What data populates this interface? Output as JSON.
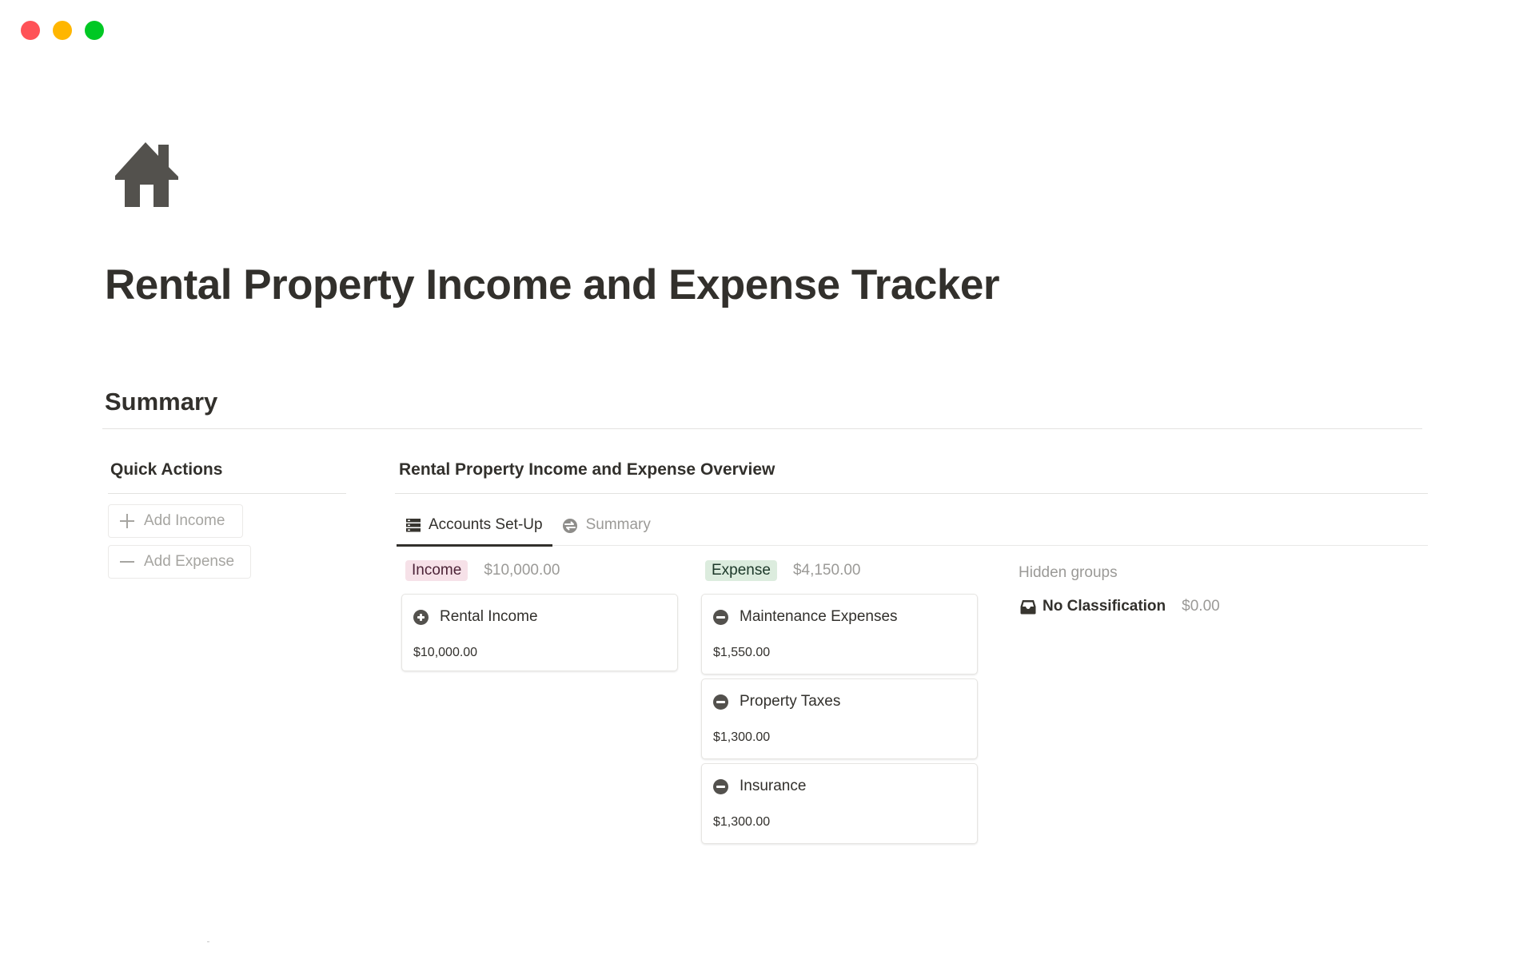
{
  "window": {
    "controls": [
      "close",
      "minimize",
      "maximize"
    ]
  },
  "page": {
    "icon": "house-icon",
    "title": "Rental Property Income and Expense Tracker"
  },
  "summary_section": {
    "heading": "Summary"
  },
  "quick_actions": {
    "heading": "Quick Actions",
    "buttons": [
      {
        "icon": "plus-icon",
        "label": "Add Income"
      },
      {
        "icon": "minus-icon",
        "label": "Add Expense"
      }
    ]
  },
  "overview": {
    "heading": "Rental Property Income and Expense Overview",
    "tabs": [
      {
        "icon": "table-icon",
        "label": "Accounts Set-Up",
        "active": true
      },
      {
        "icon": "sync-icon",
        "label": "Summary",
        "active": false
      }
    ],
    "groups": [
      {
        "tag": "Income",
        "tag_color": "#f6e1e8",
        "total": "$10,000.00",
        "cards": [
          {
            "icon": "plus-circle-icon",
            "title": "Rental Income",
            "amount": "$10,000.00"
          }
        ]
      },
      {
        "tag": "Expense",
        "tag_color": "#dcecde",
        "total": "$4,150.00",
        "cards": [
          {
            "icon": "minus-circle-icon",
            "title": "Maintenance Expenses",
            "amount": "$1,550.00"
          },
          {
            "icon": "minus-circle-icon",
            "title": "Property Taxes",
            "amount": "$1,300.00"
          },
          {
            "icon": "minus-circle-icon",
            "title": "Insurance",
            "amount": "$1,300.00"
          }
        ]
      }
    ],
    "hidden_groups": {
      "label": "Hidden groups",
      "items": [
        {
          "icon": "inbox-icon",
          "name": "No Classification",
          "total": "$0.00"
        }
      ]
    }
  }
}
